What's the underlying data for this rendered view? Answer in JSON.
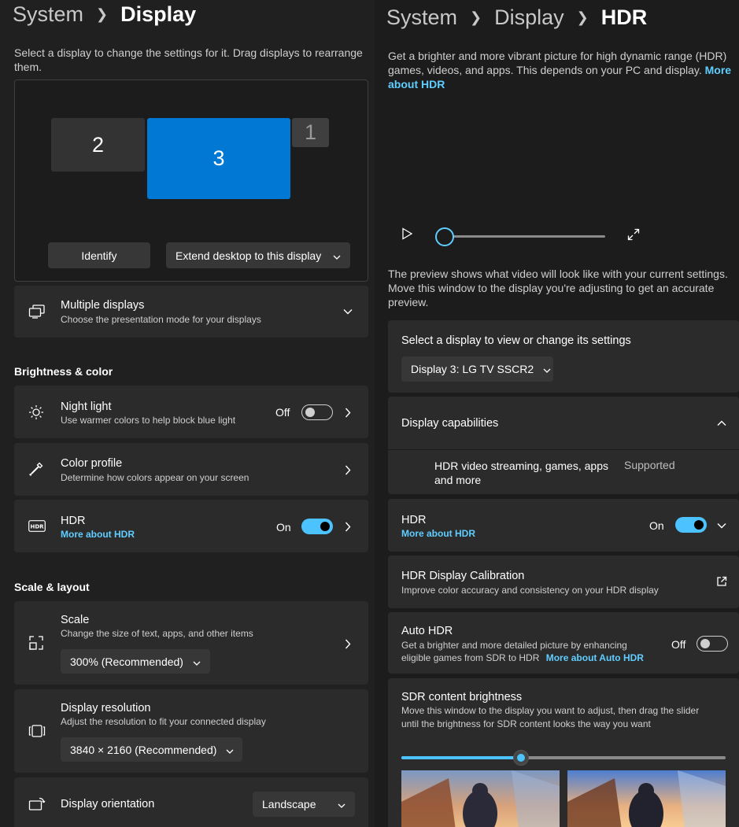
{
  "left": {
    "breadcrumb": {
      "root": "System",
      "current": "Display"
    },
    "description": "Select a display to change the settings for it. Drag displays to rearrange them.",
    "monitors": {
      "m2": "2",
      "m3": "3",
      "m1": "1"
    },
    "identify_button": "Identify",
    "extend_dropdown": "Extend desktop to this display",
    "multiple_displays": {
      "title": "Multiple displays",
      "subtitle": "Choose the presentation mode for your displays"
    },
    "brightness_heading": "Brightness & color",
    "night_light": {
      "title": "Night light",
      "subtitle": "Use warmer colors to help block blue light",
      "state": "Off"
    },
    "color_profile": {
      "title": "Color profile",
      "subtitle": "Determine how colors appear on your screen"
    },
    "hdr": {
      "title": "HDR",
      "link": "More about HDR",
      "state": "On"
    },
    "scale_heading": "Scale & layout",
    "scale": {
      "title": "Scale",
      "subtitle": "Change the size of text, apps, and other items",
      "value": "300% (Recommended)"
    },
    "resolution": {
      "title": "Display resolution",
      "subtitle": "Adjust the resolution to fit your connected display",
      "value": "3840 × 2160 (Recommended)"
    },
    "orientation": {
      "title": "Display orientation",
      "value": "Landscape"
    }
  },
  "right": {
    "breadcrumb": {
      "root": "System",
      "mid": "Display",
      "current": "HDR"
    },
    "description": "Get a brighter and more vibrant picture for high dynamic range (HDR) games, videos, and apps. This depends on your PC and display.",
    "description_link": "More about HDR",
    "video_progress": 0.0,
    "preview_note": "The preview shows what video will look like with your current settings. Move this window to the display you're adjusting to get an accurate preview.",
    "select_display": {
      "title": "Select a display to view or change its settings",
      "value": "Display 3: LG TV SSCR2"
    },
    "capabilities": {
      "title": "Display capabilities",
      "item": "HDR video streaming, games, apps and more",
      "status": "Supported"
    },
    "hdr": {
      "title": "HDR",
      "link": "More about HDR",
      "state": "On"
    },
    "calibration": {
      "title": "HDR Display Calibration",
      "subtitle": "Improve color accuracy and consistency on your HDR display"
    },
    "auto_hdr": {
      "title": "Auto HDR",
      "subtitle_line1": "Get a brighter and more detailed picture by enhancing",
      "subtitle_line2": "eligible games from SDR to HDR",
      "link": "More about Auto HDR",
      "state": "Off"
    },
    "sdr": {
      "title": "SDR content brightness",
      "desc_line1": "Move this window to the display you want to adjust, then drag the slider",
      "desc_line2": "until the brightness for SDR content looks the way you want",
      "slider_value": 0.37
    }
  },
  "colors": {
    "accent": "#4cc2ff",
    "link": "#60cdff",
    "monitor_selected": "#0078d4",
    "card": "#2b2b2b",
    "background": "#202020"
  }
}
